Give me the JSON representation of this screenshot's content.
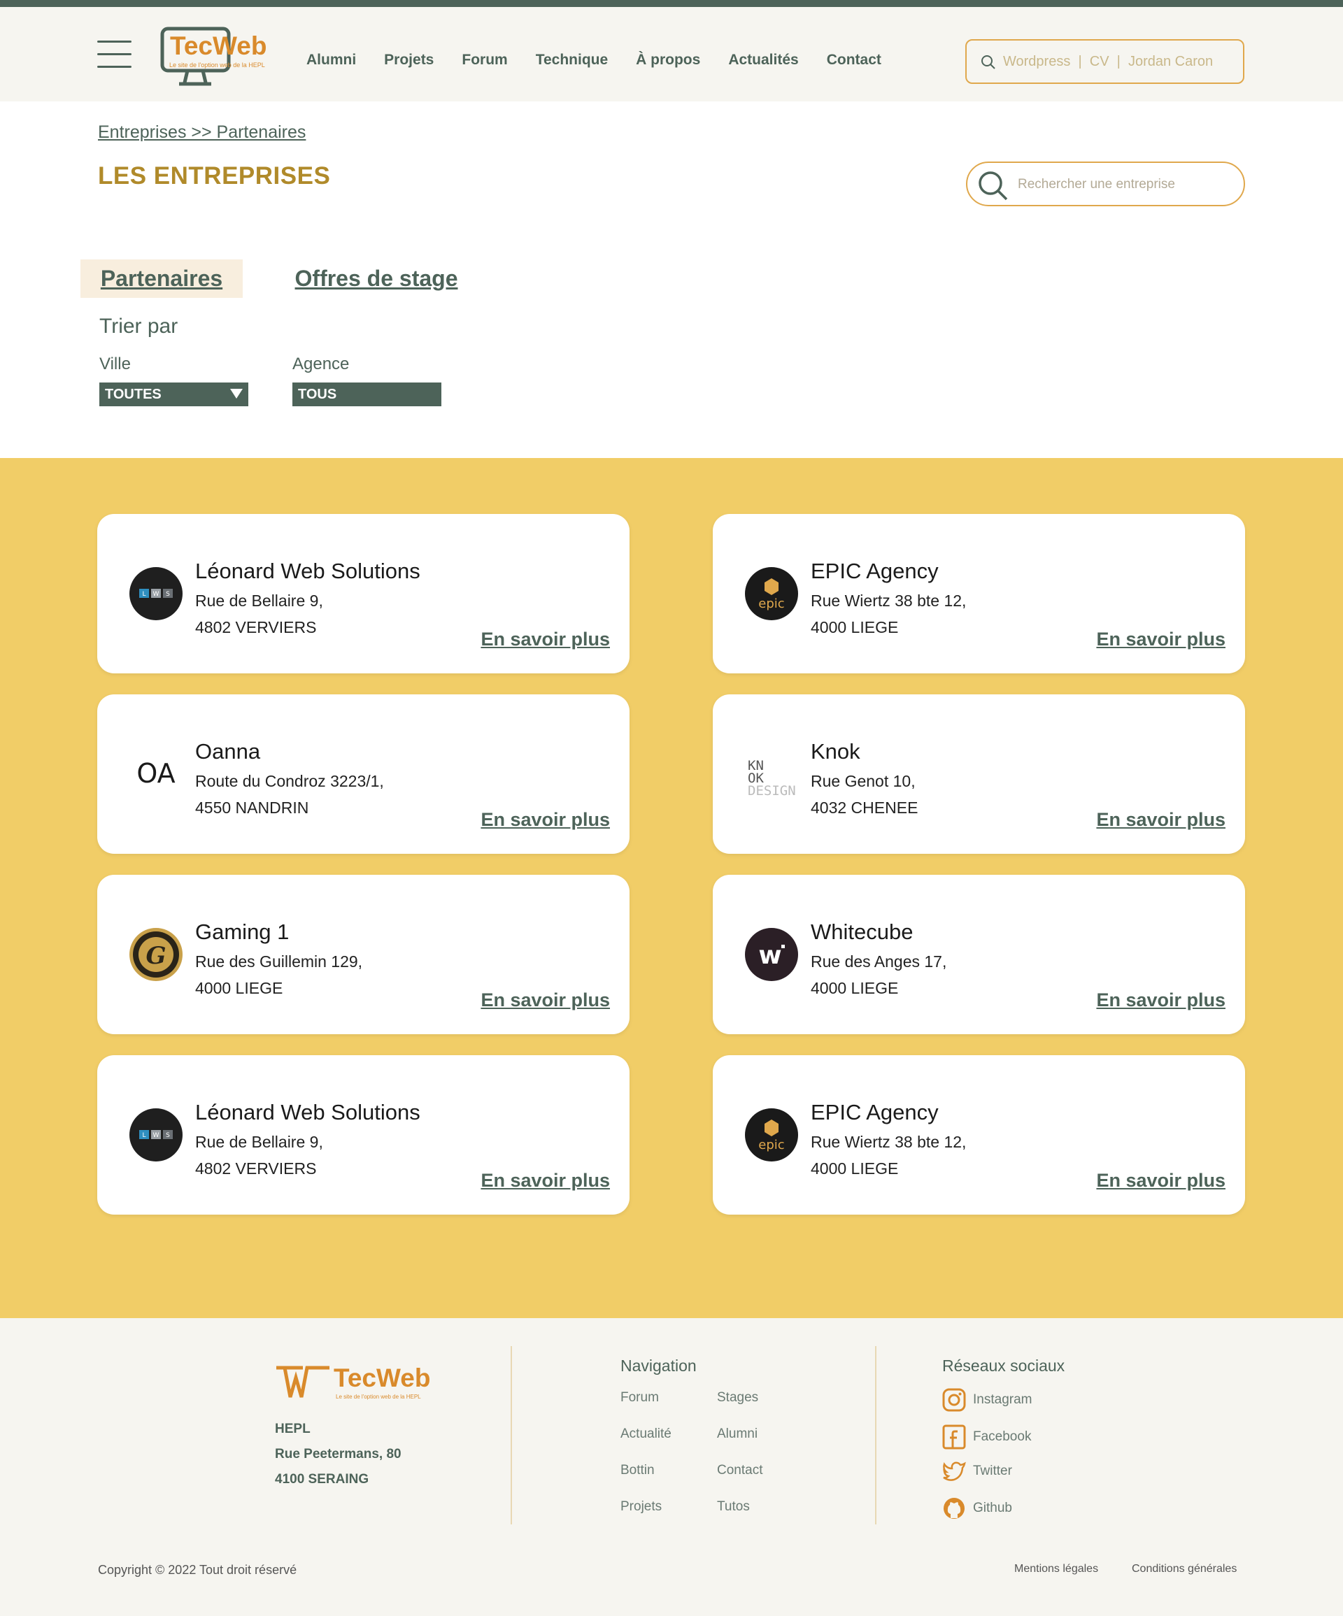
{
  "header": {
    "logo": {
      "name": "TecWeb",
      "tagline": "Le site de l'option web de la HEPL"
    },
    "nav": [
      "Alumni",
      "Projets",
      "Forum",
      "Technique",
      "À propos",
      "Actualités",
      "Contact"
    ],
    "search_placeholder": "Wordpress  |  CV  |  Jordan Caron"
  },
  "page": {
    "breadcrumb": "Entreprises >> Partenaires",
    "title": "LES ENTREPRISES",
    "company_search_placeholder": "Rechercher une entreprise",
    "tabs": {
      "active": "Partenaires",
      "other": "Offres de stage"
    },
    "sort_label": "Trier par",
    "filters": [
      {
        "label": "Ville",
        "value": "TOUTES"
      },
      {
        "label": "Agence",
        "value": "TOUS"
      }
    ]
  },
  "cards": [
    {
      "name": "Léonard Web Solutions",
      "street": "Rue de Bellaire 9,",
      "city": "4802 VERVIERS",
      "more": "En savoir plus",
      "logo": "lws-logo",
      "logo_letters": [
        "L",
        "W",
        "S"
      ]
    },
    {
      "name": "EPIC Agency",
      "street": "Rue Wiertz 38 bte 12,",
      "city": "4000 LIEGE",
      "more": "En savoir plus",
      "logo": "epic-logo",
      "logo_text": "epic"
    },
    {
      "name": "Oanna",
      "street": "Route du Condroz 3223/1,",
      "city": "4550 NANDRIN",
      "more": "En savoir plus",
      "logo": "oanna-logo",
      "logo_text": "OA"
    },
    {
      "name": "Knok",
      "street": "Rue Genot 10,",
      "city": "4032 CHENEE",
      "more": "En savoir plus",
      "logo": "knok-logo",
      "logo_lines": [
        "KN",
        "OK",
        "DESIGN"
      ]
    },
    {
      "name": "Gaming 1",
      "street": "Rue des Guillemin 129,",
      "city": "4000 LIEGE",
      "more": "En savoir plus",
      "logo": "gaming1-logo",
      "logo_text": "G"
    },
    {
      "name": "Whitecube",
      "street": "Rue des Anges 17,",
      "city": "4000 LIEGE",
      "more": "En savoir plus",
      "logo": "whitecube-logo",
      "logo_text": "w"
    },
    {
      "name": "Léonard Web Solutions",
      "street": "Rue de Bellaire 9,",
      "city": "4802 VERVIERS",
      "more": "En savoir plus",
      "logo": "lws-logo",
      "logo_letters": [
        "L",
        "W",
        "S"
      ]
    },
    {
      "name": "EPIC Agency",
      "street": "Rue Wiertz 38 bte 12,",
      "city": "4000 LIEGE",
      "more": "En savoir plus",
      "logo": "epic-logo",
      "logo_text": "epic"
    }
  ],
  "footer": {
    "logo": {
      "name": "TecWeb",
      "tagline": "Le site de l'option web de la HEPL"
    },
    "address": [
      "HEPL",
      "Rue Peetermans, 80",
      "4100 SERAING"
    ],
    "navigation_title": "Navigation",
    "navigation": [
      [
        "Forum",
        "Stages"
      ],
      [
        "Actualité",
        "Alumni"
      ],
      [
        "Bottin",
        "Contact"
      ],
      [
        "Projets",
        "Tutos"
      ]
    ],
    "social_title": "Réseaux sociaux",
    "social": [
      {
        "label": "Instagram",
        "icon": "instagram-icon"
      },
      {
        "label": "Facebook",
        "icon": "facebook-icon"
      },
      {
        "label": "Twitter",
        "icon": "twitter-icon"
      },
      {
        "label": "Github",
        "icon": "github-icon"
      }
    ],
    "copyright": "Copyright © 2022 Tout droit réservé",
    "legal": [
      "Mentions légales",
      "Conditions générales"
    ]
  },
  "colors": {
    "primary": "#4d6359",
    "accent": "#d98a2b",
    "gold": "#b08a2a",
    "yellow": "#f1cd67",
    "border": "#e0a84c"
  }
}
